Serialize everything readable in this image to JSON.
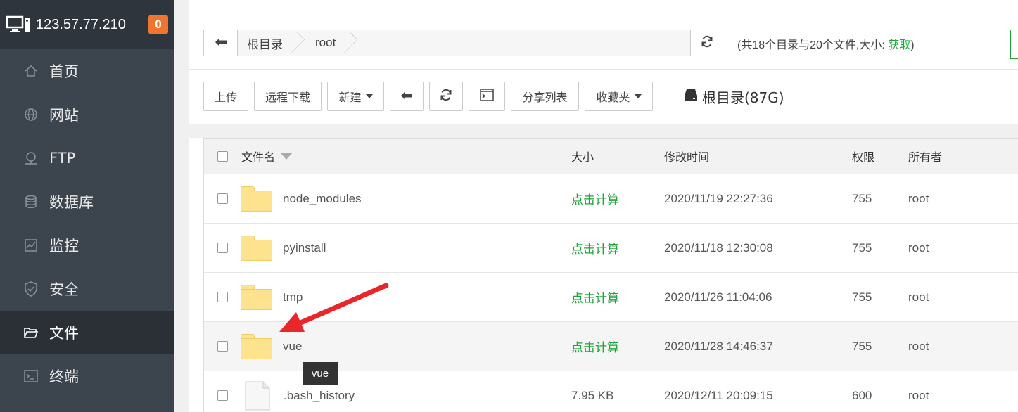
{
  "sidebar": {
    "ip": "123.57.77.210",
    "badge": "0",
    "items": [
      {
        "label": "首页",
        "icon": "home-icon"
      },
      {
        "label": "网站",
        "icon": "globe-icon"
      },
      {
        "label": "FTP",
        "icon": "ftp-icon"
      },
      {
        "label": "数据库",
        "icon": "database-icon"
      },
      {
        "label": "监控",
        "icon": "monitor-chart-icon"
      },
      {
        "label": "安全",
        "icon": "shield-icon"
      },
      {
        "label": "文件",
        "icon": "folder-icon",
        "active": true
      },
      {
        "label": "终端",
        "icon": "terminal-icon"
      }
    ]
  },
  "path": {
    "crumbs": [
      "根目录",
      "root"
    ],
    "summary_prefix": "(共18个目录与20个文件,大小: ",
    "summary_link": "获取",
    "summary_suffix": ")"
  },
  "toolbar": {
    "upload": "上传",
    "remote_download": "远程下载",
    "new": "新建",
    "share_list": "分享列表",
    "favorites": "收藏夹",
    "disk_label": "根目录(87G)"
  },
  "table": {
    "headers": {
      "name": "文件名",
      "size": "大小",
      "mtime": "修改时间",
      "perm": "权限",
      "owner": "所有者"
    },
    "rows": [
      {
        "name": "node_modules",
        "type": "folder",
        "size": "点击计算",
        "mtime": "2020/11/19 22:27:36",
        "perm": "755",
        "owner": "root"
      },
      {
        "name": "pyinstall",
        "type": "folder",
        "size": "点击计算",
        "mtime": "2020/11/18 12:30:08",
        "perm": "755",
        "owner": "root"
      },
      {
        "name": "tmp",
        "type": "folder",
        "size": "点击计算",
        "mtime": "2020/11/26 11:04:06",
        "perm": "755",
        "owner": "root"
      },
      {
        "name": "vue",
        "type": "folder",
        "size": "点击计算",
        "mtime": "2020/11/28 14:46:37",
        "perm": "755",
        "owner": "root"
      },
      {
        "name": ".bash_history",
        "type": "file",
        "size": "7.95 KB",
        "mtime": "2020/12/11 20:09:15",
        "perm": "600",
        "owner": "root"
      }
    ]
  },
  "tooltip": "vue",
  "colors": {
    "accent_green": "#20a53a",
    "sidebar_bg": "#3c444d",
    "badge_orange": "#f0762f",
    "annotation_red": "#e8262b"
  }
}
